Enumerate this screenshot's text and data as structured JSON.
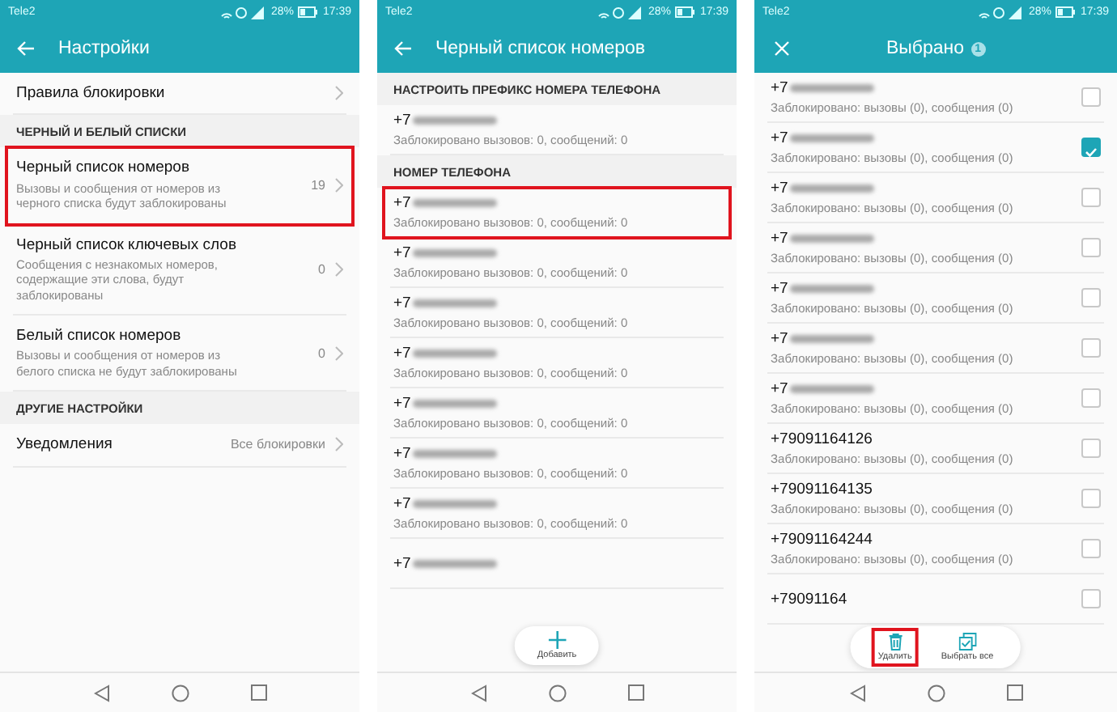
{
  "settings_screen": {
    "status_bar": {
      "carrier": "Tele2",
      "battery": "28%",
      "time": "17:39"
    },
    "title": "Настройки",
    "rows": [
      {
        "kind": "item",
        "title": "Правила блокировки",
        "highlighted": false
      },
      {
        "kind": "header",
        "title": "ЧЕРНЫЙ И БЕЛЫЙ СПИСКИ"
      },
      {
        "kind": "item",
        "title": "Черный список номеров",
        "subtitle": "Вызовы и сообщения от номеров из черного списка будут заблокированы",
        "value": "19",
        "highlighted": true
      },
      {
        "kind": "item",
        "title": "Черный список ключевых слов",
        "subtitle": "Сообщения с незнакомых номеров, содержащие эти слова, будут заблокированы",
        "value": "0",
        "highlighted": false
      },
      {
        "kind": "item",
        "title": "Белый список номеров",
        "subtitle": "Вызовы и сообщения от номеров из белого списка не будут заблокированы",
        "value": "0",
        "highlighted": false
      },
      {
        "kind": "header",
        "title": "ДРУГИЕ НАСТРОЙКИ"
      },
      {
        "kind": "item",
        "title": "Уведомления",
        "value": "Все блокировки",
        "highlighted": false
      }
    ]
  },
  "blacklist_screen": {
    "status_bar": {
      "carrier": "Tele2",
      "battery": "28%",
      "time": "17:39"
    },
    "title": "Черный список номеров",
    "rows": [
      {
        "kind": "header",
        "title": "НАСТРОИТЬ ПРЕФИКС НОМЕРА ТЕЛЕФОНА"
      },
      {
        "kind": "item",
        "number": "+7",
        "blurred": true,
        "subtitle": "Заблокировано вызовов: 0, сообщений: 0",
        "highlighted": false
      },
      {
        "kind": "header",
        "title": "НОМЕР ТЕЛЕФОНА"
      },
      {
        "kind": "item",
        "number": "+7",
        "blurred": true,
        "subtitle": "Заблокировано вызовов: 0, сообщений: 0",
        "highlighted": true
      },
      {
        "kind": "item",
        "number": "+7",
        "blurred": true,
        "subtitle": "Заблокировано вызовов: 0, сообщений: 0",
        "highlighted": false
      },
      {
        "kind": "item",
        "number": "+7",
        "blurred": true,
        "subtitle": "Заблокировано вызовов: 0, сообщений: 0",
        "highlighted": false
      },
      {
        "kind": "item",
        "number": "+7",
        "blurred": true,
        "subtitle": "Заблокировано вызовов: 0, сообщений: 0",
        "highlighted": false
      },
      {
        "kind": "item",
        "number": "+7",
        "blurred": true,
        "subtitle": "Заблокировано вызовов: 0, сообщений: 0",
        "highlighted": false
      },
      {
        "kind": "item",
        "number": "+7",
        "blurred": true,
        "subtitle": "Заблокировано вызовов: 0, сообщений: 0",
        "highlighted": false
      },
      {
        "kind": "item",
        "number": "+7",
        "blurred": true,
        "subtitle": "Заблокировано вызовов: 0, сообщений: 0",
        "highlighted": false
      },
      {
        "kind": "item",
        "number": "+7",
        "blurred": true,
        "highlighted": false
      }
    ],
    "add_button": {
      "label": "Добавить"
    }
  },
  "selection_screen": {
    "status_bar": {
      "carrier": "Tele2",
      "battery": "28%",
      "time": "17:39"
    },
    "title": "Выбрано",
    "count": "1",
    "items": [
      {
        "number": "+7",
        "blurred": true,
        "subtitle": "Заблокировано: вызовы (0), сообщения (0)",
        "checked": false
      },
      {
        "number": "+7",
        "blurred": true,
        "subtitle": "Заблокировано: вызовы (0), сообщения (0)",
        "checked": true
      },
      {
        "number": "+7",
        "blurred": true,
        "subtitle": "Заблокировано: вызовы (0), сообщения (0)",
        "checked": false
      },
      {
        "number": "+7",
        "blurred": true,
        "subtitle": "Заблокировано: вызовы (0), сообщения (0)",
        "checked": false
      },
      {
        "number": "+7",
        "blurred": true,
        "subtitle": "Заблокировано: вызовы (0), сообщения (0)",
        "checked": false
      },
      {
        "number": "+7",
        "blurred": true,
        "subtitle": "Заблокировано: вызовы (0), сообщения (0)",
        "checked": false
      },
      {
        "number": "+7",
        "blurred": true,
        "subtitle": "Заблокировано: вызовы (0), сообщения (0)",
        "checked": false
      },
      {
        "number": "+79091164126",
        "blurred": false,
        "subtitle": "Заблокировано: вызовы (0), сообщения (0)",
        "checked": false
      },
      {
        "number": "+79091164135",
        "blurred": false,
        "subtitle": "Заблокировано: вызовы (0), сообщения (0)",
        "checked": false
      },
      {
        "number": "+79091164244",
        "blurred": false,
        "subtitle": "Заблокировано: вызовы (0), сообщения (0)",
        "checked": false
      },
      {
        "number": "+79091164",
        "blurred": false,
        "checked": false
      }
    ],
    "actions": [
      {
        "kind": "delete",
        "label": "Удалить",
        "highlighted": true
      },
      {
        "kind": "select_all",
        "label": "Выбрать все",
        "highlighted": false
      }
    ]
  }
}
